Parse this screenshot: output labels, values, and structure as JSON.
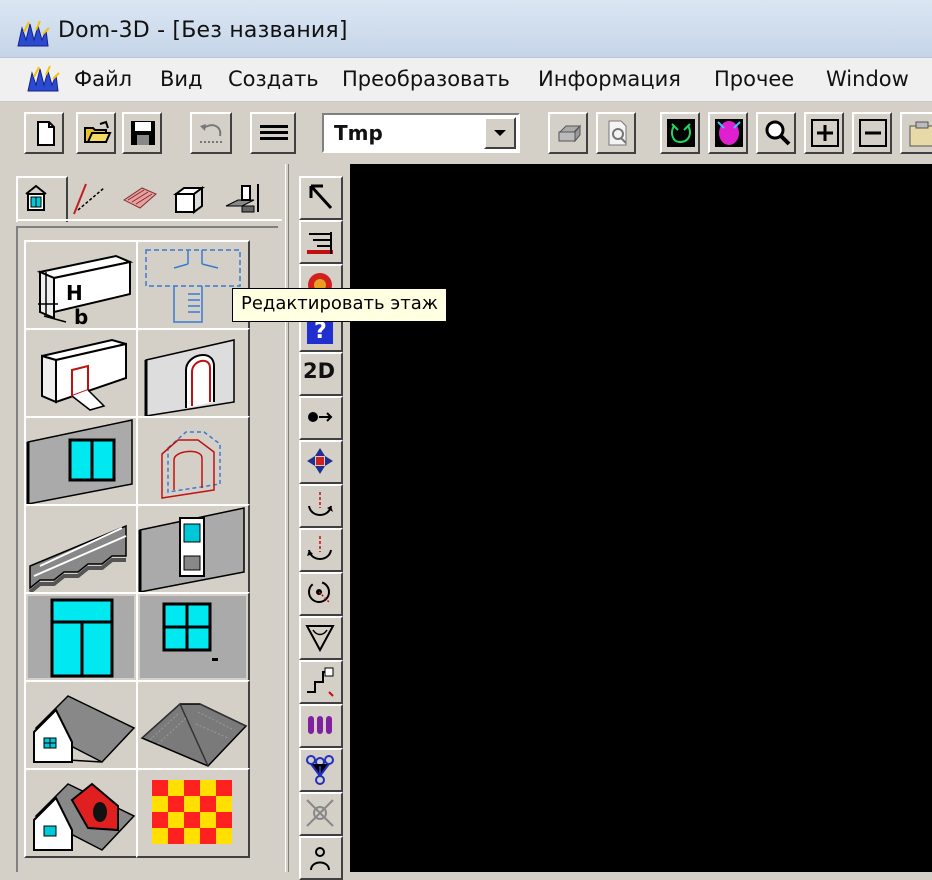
{
  "window": {
    "title": "Dom-3D - [Без названия]"
  },
  "menu": {
    "items": [
      "Файл",
      "Вид",
      "Создать",
      "Преобразовать",
      "Информация",
      "Прочее",
      "Window"
    ]
  },
  "toolbar": {
    "combo_value": "Tmp",
    "buttons": [
      "new-file-icon",
      "open-folder-icon",
      "save-disk-icon",
      "undo-icon",
      "lines-icon",
      "print-icon",
      "print-preview-icon",
      "render-green-icon",
      "render-magenta-icon",
      "zoom-icon",
      "zoom-in-icon",
      "zoom-out-icon",
      "paste-icon"
    ]
  },
  "left_panel": {
    "tabs": [
      "house-tab-icon",
      "line-tab-icon",
      "roof-tab-icon",
      "box-tab-icon",
      "furniture-tab-icon"
    ],
    "tiles": [
      "wall-tool-icon",
      "floor-plan-tool-icon",
      "wall-opening-tool-icon",
      "arch-tool-icon",
      "window-tool-icon",
      "niche-tool-icon",
      "stairs-tool-icon",
      "door-tool-icon",
      "french-window-tool-icon",
      "four-pane-window-tool-icon",
      "gable-roof-tool-icon",
      "hip-roof-tool-icon",
      "dormer-roof-tool-icon",
      "checker-pattern-tool-icon"
    ]
  },
  "vertical_toolbar": {
    "label_2d": "2D"
  },
  "tooltip": {
    "text": "Редактировать этаж"
  },
  "colors": {
    "canvas": "#000000",
    "tooltip_bg": "#ffffe1",
    "panel": "#d4d0c8",
    "accent_cyan": "#00e8f0"
  }
}
